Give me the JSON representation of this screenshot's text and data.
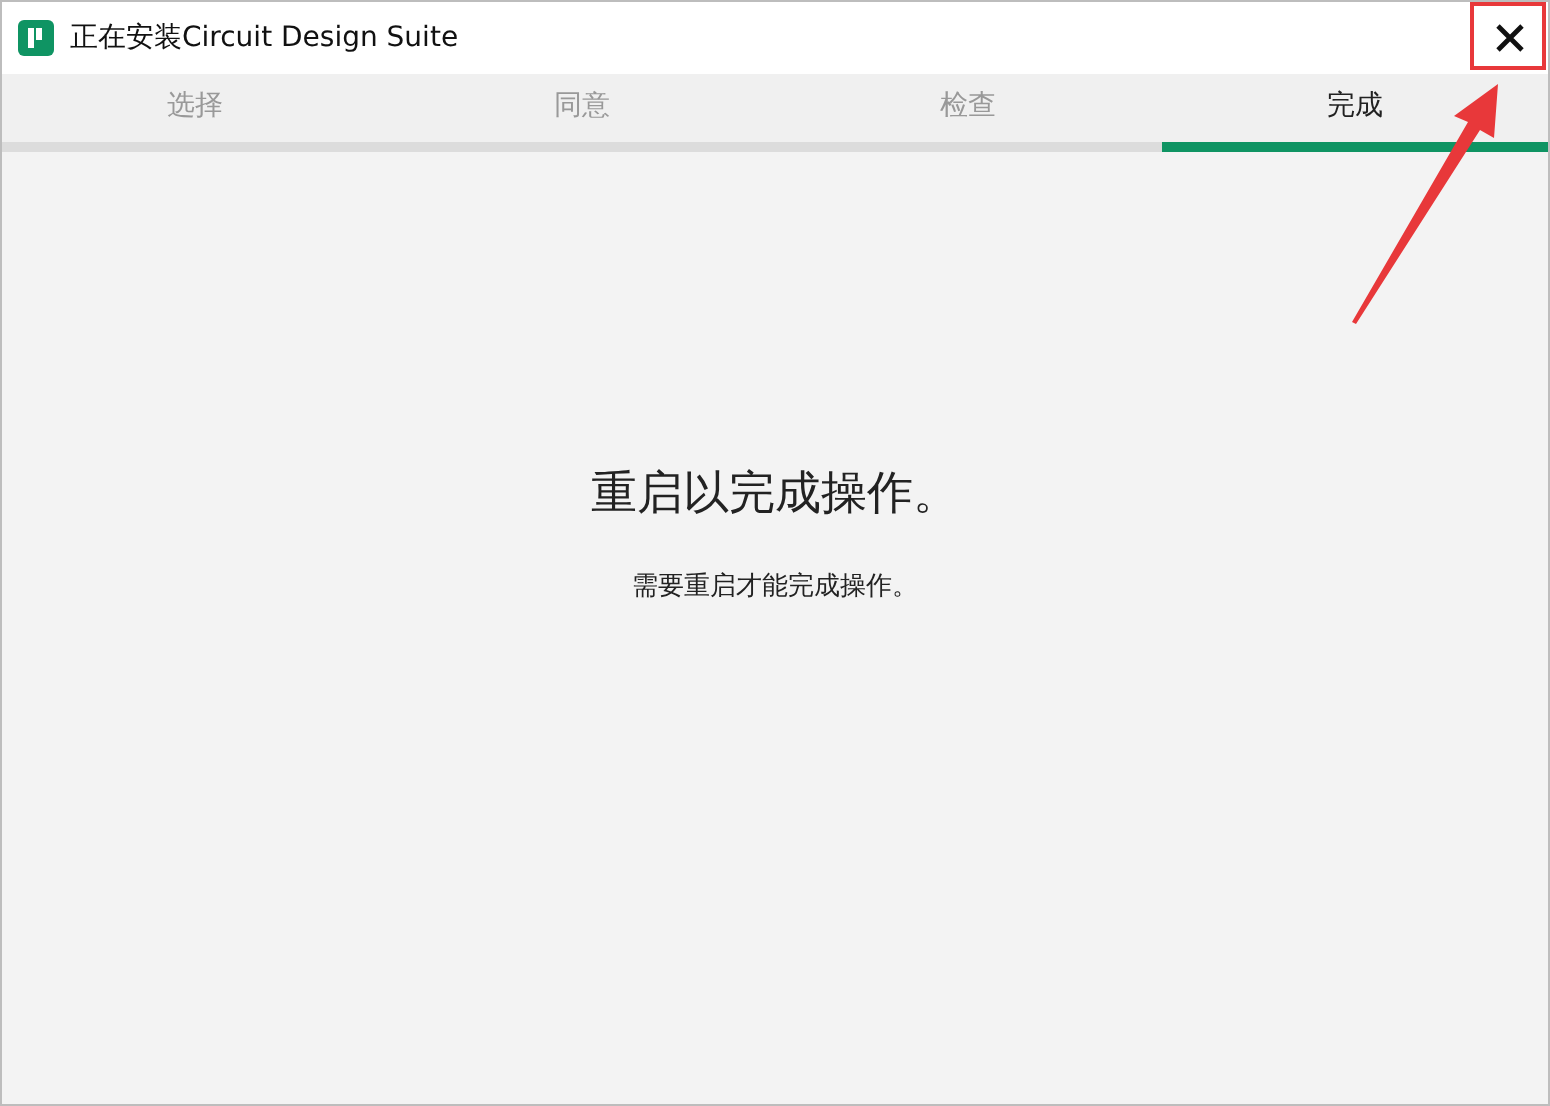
{
  "window": {
    "title": "正在安装Circuit Design Suite"
  },
  "tabs": [
    {
      "label": "选择",
      "selected": false
    },
    {
      "label": "同意",
      "selected": false
    },
    {
      "label": "检查",
      "selected": false
    },
    {
      "label": "完成",
      "selected": true
    }
  ],
  "content": {
    "heading": "重启以完成操作。",
    "message": "需要重启才能完成操作。"
  }
}
